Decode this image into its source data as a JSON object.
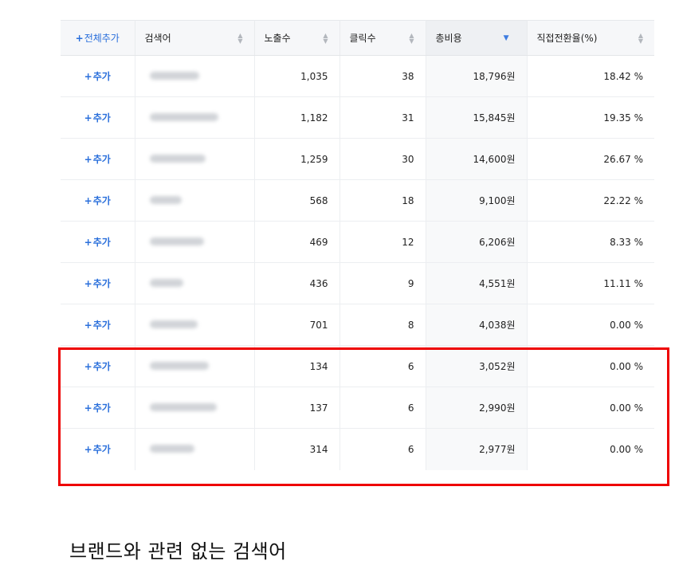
{
  "header": {
    "add_all": "전체추가",
    "keyword": "검색어",
    "impressions": "노출수",
    "clicks": "클릭수",
    "total_cost": "총비용",
    "conversion_rate": "직접전환율(%)"
  },
  "row_add_label": "추가",
  "rows": [
    {
      "impressions": "1,035",
      "clicks": "38",
      "cost": "18,796원",
      "rate": "18.42 %"
    },
    {
      "impressions": "1,182",
      "clicks": "31",
      "cost": "15,845원",
      "rate": "19.35 %"
    },
    {
      "impressions": "1,259",
      "clicks": "30",
      "cost": "14,600원",
      "rate": "26.67 %"
    },
    {
      "impressions": "568",
      "clicks": "18",
      "cost": "9,100원",
      "rate": "22.22 %"
    },
    {
      "impressions": "469",
      "clicks": "12",
      "cost": "6,206원",
      "rate": "8.33 %"
    },
    {
      "impressions": "436",
      "clicks": "9",
      "cost": "4,551원",
      "rate": "11.11 %"
    },
    {
      "impressions": "701",
      "clicks": "8",
      "cost": "4,038원",
      "rate": "0.00 %"
    },
    {
      "impressions": "134",
      "clicks": "6",
      "cost": "3,052원",
      "rate": "0.00 %"
    },
    {
      "impressions": "137",
      "clicks": "6",
      "cost": "2,990원",
      "rate": "0.00 %"
    },
    {
      "impressions": "314",
      "clicks": "6",
      "cost": "2,977원",
      "rate": "0.00 %"
    }
  ],
  "caption": "브랜드와 관련 없는 검색어",
  "colors": {
    "accent": "#2a6fdb",
    "highlight": "#ee0000",
    "sort_active": "#3d7be0"
  },
  "sort": {
    "column": "total_cost",
    "direction": "descending"
  }
}
